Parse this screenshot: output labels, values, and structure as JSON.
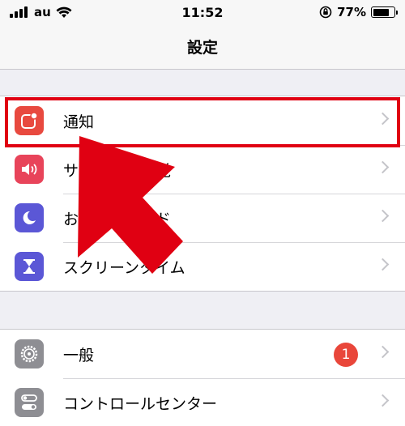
{
  "status_bar": {
    "carrier": "au",
    "time": "11:52",
    "battery_percent": "77%",
    "battery_level": 0.77
  },
  "nav": {
    "title": "設定"
  },
  "group1": [
    {
      "label": "通知",
      "icon": "notifications-icon",
      "color": "#e8493f"
    },
    {
      "label": "サウンドと触覚",
      "icon": "sound-icon",
      "color": "#e8445a"
    },
    {
      "label": "おやすみモード",
      "icon": "moon-icon",
      "color": "#5b57d6"
    },
    {
      "label": "スクリーンタイム",
      "icon": "hourglass-icon",
      "color": "#5b57d6"
    }
  ],
  "group2": [
    {
      "label": "一般",
      "icon": "gear-icon",
      "color": "#8e8e93",
      "badge": "1"
    },
    {
      "label": "コントロールセンター",
      "icon": "toggles-icon",
      "color": "#8e8e93"
    }
  ],
  "colors": {
    "highlight": "#e00012",
    "arrow": "#e00012"
  }
}
